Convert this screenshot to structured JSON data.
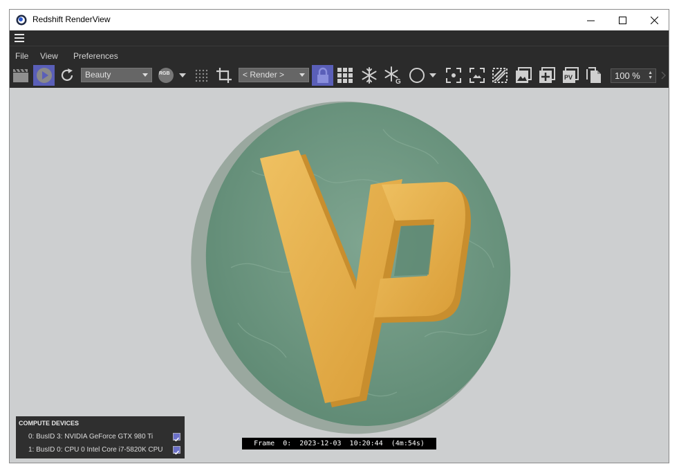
{
  "window": {
    "title": "Redshift RenderView"
  },
  "menu": {
    "file": "File",
    "view": "View",
    "preferences": "Preferences"
  },
  "toolbar": {
    "aov_select": "Beauty",
    "channel_label": "RGB",
    "camera_select": "< Render >",
    "zoom_value": "100 %"
  },
  "compute_devices": {
    "header": "COMPUTE DEVICES",
    "devices": [
      {
        "label": "0: BusID 3: NVIDIA GeForce GTX 980 Ti",
        "checked": true
      },
      {
        "label": "1: BusID 0: CPU 0 Intel Core i7-5820K CPU",
        "checked": true
      }
    ]
  },
  "status": {
    "frame_line": "Frame  0:  2023-12-03  10:20:44  (4m:54s)"
  },
  "colors": {
    "toolbar_bg": "#2b2b2b",
    "active_button": "#5a5fb8",
    "viewport_bg": "#cdcfd0",
    "disc": "#6f9983",
    "logo": "#e2ad4a"
  },
  "icons": {
    "app": "cinema4d-icon",
    "clapper": "clapperboard-icon",
    "play": "play-icon",
    "refresh": "refresh-icon",
    "dots": "sample-grid-icon",
    "crop": "crop-icon",
    "lock": "lock-icon",
    "grid": "bucket-grid-icon",
    "snow": "snowflake-icon",
    "snow_g": "snowflake-g-icon",
    "circle": "circle-icon",
    "focus": "focus-icon",
    "fit": "fit-icon",
    "compare": "compare-icon",
    "image": "image-icon",
    "add": "add-snapshot-icon",
    "pv": "pv-icon",
    "copy": "copy-icon"
  }
}
